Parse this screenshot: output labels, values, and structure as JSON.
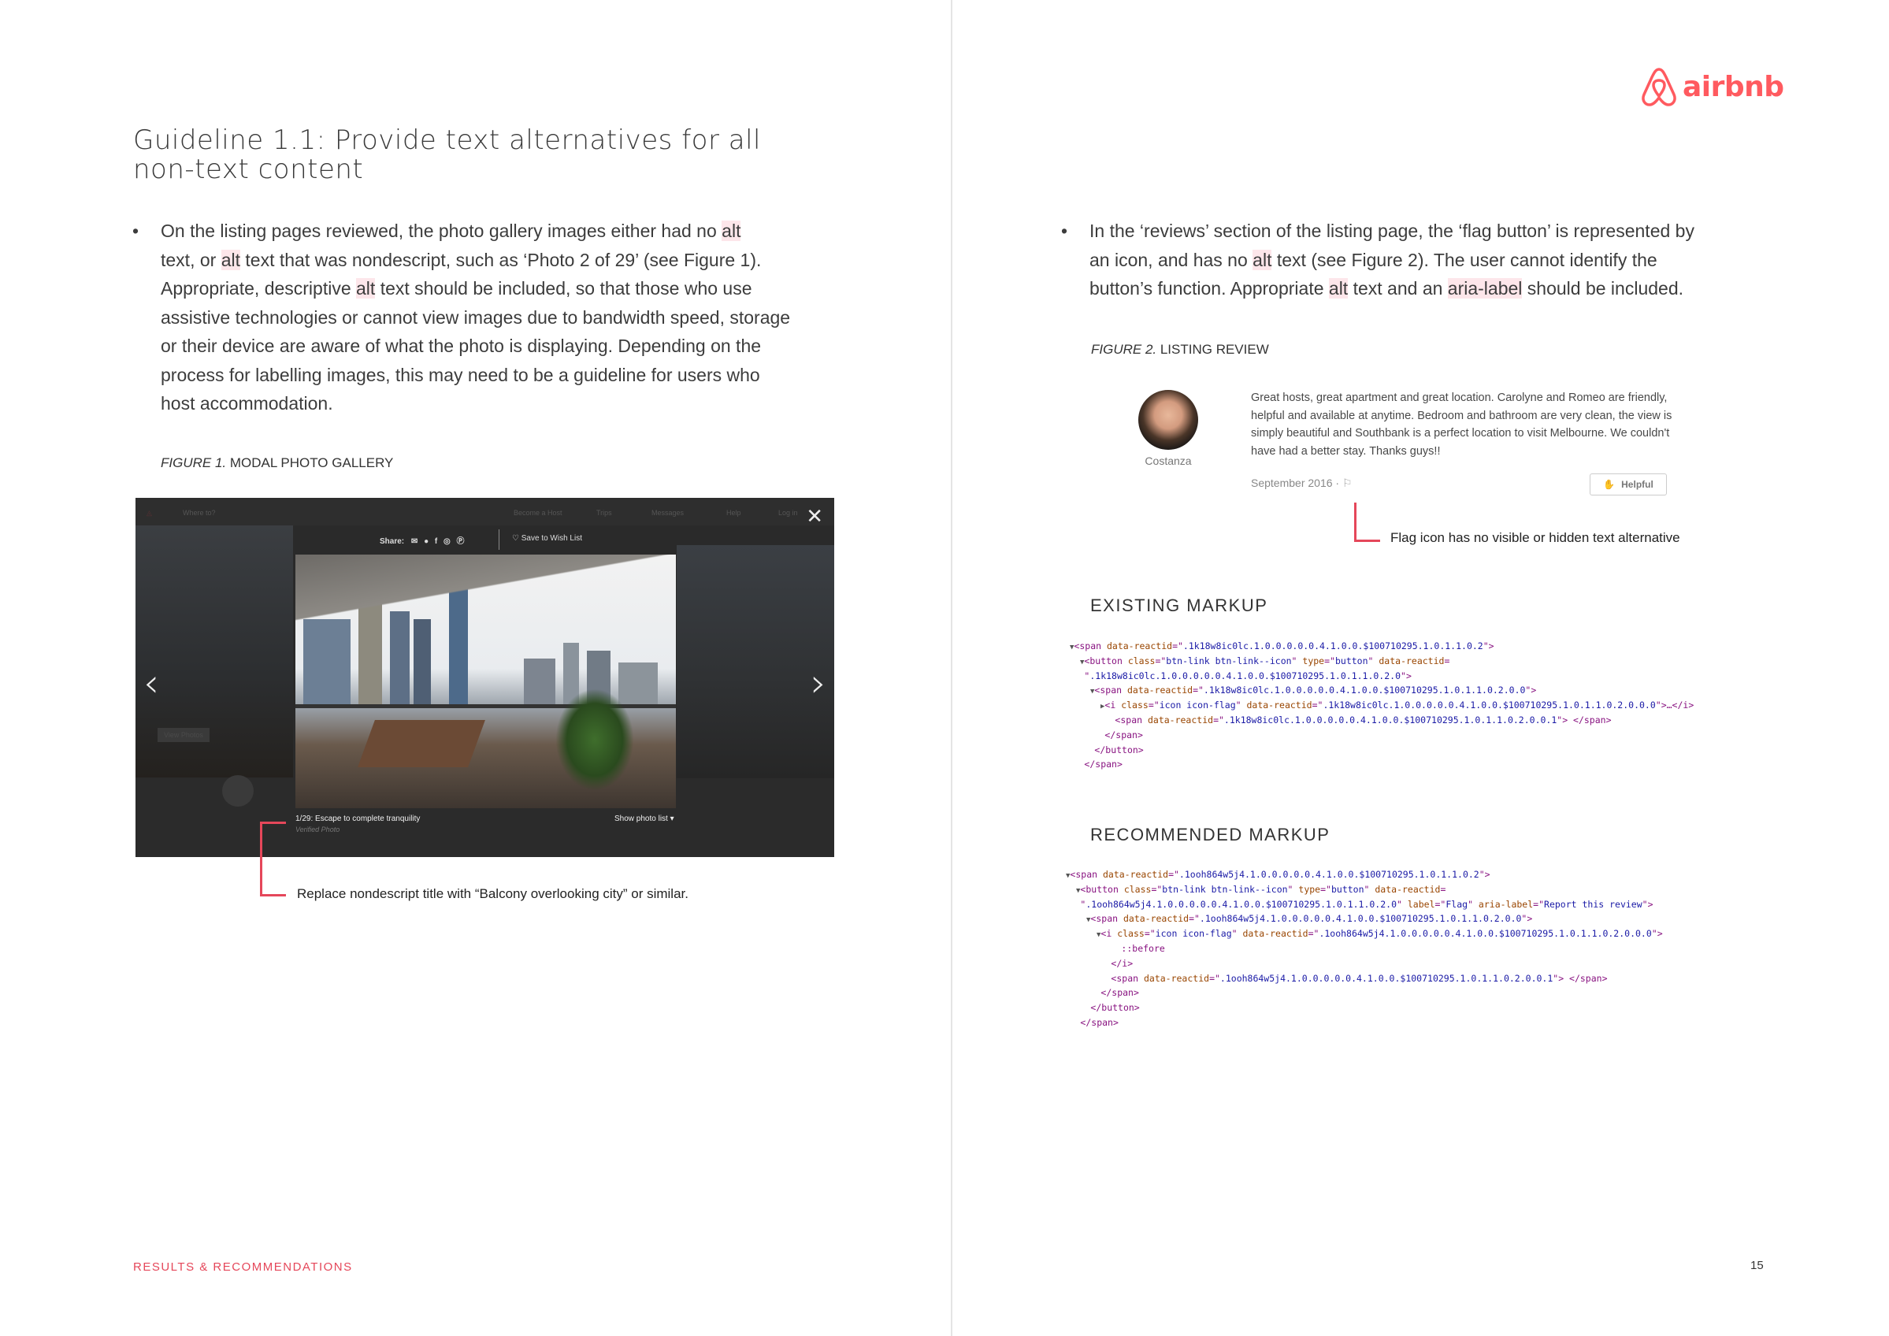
{
  "left_page": {
    "title_lines": [
      "Guideline 1.1: Provide text alternatives for all",
      "non-text content"
    ],
    "bullet_lines": [
      [
        {
          "text": "On the listing pages reviewed, the photo gallery images either had no "
        },
        {
          "text": "alt",
          "hl": true
        }
      ],
      [
        {
          "text": "text, or "
        },
        {
          "text": "alt",
          "hl": true
        },
        {
          "text": " text that was nondescript, such as ‘Photo 2 of 29’ (see Figure 1)."
        }
      ],
      [
        {
          "text": "Appropriate, descriptive "
        },
        {
          "text": "alt",
          "hl": true
        },
        {
          "text": " text should be included, so that those who use"
        }
      ],
      [
        {
          "text": "assistive technologies or cannot view images due to bandwidth speed, storage"
        }
      ],
      [
        {
          "text": "or their device are aware of what the photo is displaying. Depending on the"
        }
      ],
      [
        {
          "text": "process for labelling images, this may need to be a guideline for users who"
        }
      ],
      [
        {
          "text": "host accommodation."
        }
      ]
    ],
    "figure_caption": {
      "label": "FIGURE 1.",
      "text": " MODAL PHOTO GALLERY"
    },
    "gallery": {
      "nav_items": [
        "Where to?",
        "Become a Host",
        "Trips",
        "Messages",
        "Help",
        "Log in"
      ],
      "share_label": "Share:",
      "share_icons": [
        "✉",
        "●",
        "f",
        "◎",
        "Ⓟ"
      ],
      "wishlist_label": "♡ Save to Wish List",
      "close_icon": "✕",
      "prev_icon": "‹",
      "next_icon": "›",
      "photo_caption": "1/29: Escape to complete tranquility",
      "verified": "Verified Photo",
      "show_photo_list": "Show photo list ▾",
      "view_photos": "View Photos"
    },
    "annotation": "Replace nondescript title with “Balcony overlooking city” or similar.",
    "footer": "RESULTS & RECOMMENDATIONS"
  },
  "right_page": {
    "logo_word": "airbnb",
    "brand_color": "#ff5a5f",
    "bullet_lines": [
      [
        {
          "text": "In the ‘reviews’ section of the listing page, the ‘flag button’ is represented by"
        }
      ],
      [
        {
          "text": "an icon, and has no "
        },
        {
          "text": "alt",
          "hl": true
        },
        {
          "text": " text (see Figure 2). The user cannot identify the"
        }
      ],
      [
        {
          "text": "button’s function. Appropriate "
        },
        {
          "text": "alt",
          "hl": true
        },
        {
          "text": " text and an "
        },
        {
          "text": "aria-label",
          "hl": true
        },
        {
          "text": " should be included."
        }
      ]
    ],
    "figure_caption": {
      "label": "FIGURE 2.",
      "text": " LISTING REVIEW"
    },
    "review": {
      "reviewer": "Costanza",
      "text": "Great hosts, great apartment and great location. Carolyne and Romeo are friendly, helpful and available at anytime. Bedroom and bathroom are very clean, the view is simply beautiful and Southbank is a perfect location to visit Melbourne. We couldn't have had a better stay. Thanks guys!!",
      "date": "September 2016 ·",
      "flag_icon": "⚐",
      "helpful_icon": "✋",
      "helpful_label": "Helpful"
    },
    "annotation": "Flag icon has no visible or hidden text alternative",
    "existing_heading": "EXISTING MARKUP",
    "existing_code": [
      {
        "indent": 0,
        "tri": "▼",
        "tokens": [
          [
            "tag",
            "<span "
          ],
          [
            "attr",
            "data-reactid"
          ],
          [
            "tag",
            "=\""
          ],
          [
            "val",
            ".1k18w8ic0lc.1.0.0.0.0.0.4.1.0.0.$100710295.1.0.1.1.0.2"
          ],
          [
            "tag",
            "\">"
          ]
        ]
      },
      {
        "indent": 1,
        "tri": "▼",
        "tokens": [
          [
            "tag",
            "<button "
          ],
          [
            "attr",
            "class"
          ],
          [
            "tag",
            "=\""
          ],
          [
            "val",
            "btn-link btn-link--icon"
          ],
          [
            "tag",
            "\" "
          ],
          [
            "attr",
            "type"
          ],
          [
            "tag",
            "=\""
          ],
          [
            "val",
            "button"
          ],
          [
            "tag",
            "\" "
          ],
          [
            "attr",
            "data-reactid"
          ],
          [
            "tag",
            "="
          ]
        ]
      },
      {
        "indent": 1,
        "tri": "",
        "tokens": [
          [
            "tag",
            "\""
          ],
          [
            "val",
            ".1k18w8ic0lc.1.0.0.0.0.0.4.1.0.0.$100710295.1.0.1.1.0.2.0"
          ],
          [
            "tag",
            "\">"
          ]
        ]
      },
      {
        "indent": 2,
        "tri": "▼",
        "tokens": [
          [
            "tag",
            "<span "
          ],
          [
            "attr",
            "data-reactid"
          ],
          [
            "tag",
            "=\""
          ],
          [
            "val",
            ".1k18w8ic0lc.1.0.0.0.0.0.4.1.0.0.$100710295.1.0.1.1.0.2.0.0"
          ],
          [
            "tag",
            "\">"
          ]
        ]
      },
      {
        "indent": 3,
        "tri": "▶",
        "tokens": [
          [
            "tag",
            "<i "
          ],
          [
            "attr",
            "class"
          ],
          [
            "tag",
            "=\""
          ],
          [
            "val",
            "icon icon-flag"
          ],
          [
            "tag",
            "\" "
          ],
          [
            "attr",
            "data-reactid"
          ],
          [
            "tag",
            "=\""
          ],
          [
            "val",
            ".1k18w8ic0lc.1.0.0.0.0.0.4.1.0.0.$100710295.1.0.1.1.0.2.0.0.0"
          ],
          [
            "tag",
            "\">…</i>"
          ]
        ]
      },
      {
        "indent": 4,
        "tri": "",
        "tokens": [
          [
            "tag",
            "<span "
          ],
          [
            "attr",
            "data-reactid"
          ],
          [
            "tag",
            "=\""
          ],
          [
            "val",
            ".1k18w8ic0lc.1.0.0.0.0.0.4.1.0.0.$100710295.1.0.1.1.0.2.0.0.1"
          ],
          [
            "tag",
            "\"> </span>"
          ]
        ]
      },
      {
        "indent": 3,
        "tri": "",
        "tokens": [
          [
            "tag",
            "</span>"
          ]
        ]
      },
      {
        "indent": 2,
        "tri": "",
        "tokens": [
          [
            "tag",
            "</button>"
          ]
        ]
      },
      {
        "indent": 1,
        "tri": "",
        "tokens": [
          [
            "tag",
            "</span>"
          ]
        ]
      }
    ],
    "recommended_heading": "RECOMMENDED MARKUP",
    "recommended_code": [
      {
        "indent": 0,
        "tri": "▼",
        "tokens": [
          [
            "tag",
            "<span "
          ],
          [
            "attr",
            "data-reactid"
          ],
          [
            "tag",
            "=\""
          ],
          [
            "val",
            ".1ooh864w5j4.1.0.0.0.0.0.4.1.0.0.$100710295.1.0.1.1.0.2"
          ],
          [
            "tag",
            "\">"
          ]
        ]
      },
      {
        "indent": 1,
        "tri": "▼",
        "tokens": [
          [
            "tag",
            "<button "
          ],
          [
            "attr",
            "class"
          ],
          [
            "tag",
            "=\""
          ],
          [
            "val",
            "btn-link btn-link--icon"
          ],
          [
            "tag",
            "\" "
          ],
          [
            "attr",
            "type"
          ],
          [
            "tag",
            "=\""
          ],
          [
            "val",
            "button"
          ],
          [
            "tag",
            "\" "
          ],
          [
            "attr",
            "data-reactid"
          ],
          [
            "tag",
            "="
          ]
        ]
      },
      {
        "indent": 1,
        "tri": "",
        "tokens": [
          [
            "tag",
            "\""
          ],
          [
            "val",
            ".1ooh864w5j4.1.0.0.0.0.0.4.1.0.0.$100710295.1.0.1.1.0.2.0"
          ],
          [
            "tag",
            "\" "
          ],
          [
            "attr",
            "label"
          ],
          [
            "tag",
            "=\""
          ],
          [
            "val",
            "Flag"
          ],
          [
            "tag",
            "\" "
          ],
          [
            "attr",
            "aria-label"
          ],
          [
            "tag",
            "=\""
          ],
          [
            "val",
            "Report this review"
          ],
          [
            "tag",
            "\">"
          ]
        ]
      },
      {
        "indent": 2,
        "tri": "▼",
        "tokens": [
          [
            "tag",
            "<span "
          ],
          [
            "attr",
            "data-reactid"
          ],
          [
            "tag",
            "=\""
          ],
          [
            "val",
            ".1ooh864w5j4.1.0.0.0.0.0.4.1.0.0.$100710295.1.0.1.1.0.2.0.0"
          ],
          [
            "tag",
            "\">"
          ]
        ]
      },
      {
        "indent": 3,
        "tri": "▼",
        "tokens": [
          [
            "tag",
            "<i "
          ],
          [
            "attr",
            "class"
          ],
          [
            "tag",
            "=\""
          ],
          [
            "val",
            "icon icon-flag"
          ],
          [
            "tag",
            "\" "
          ],
          [
            "attr",
            "data-reactid"
          ],
          [
            "tag",
            "=\""
          ],
          [
            "val",
            ".1ooh864w5j4.1.0.0.0.0.0.4.1.0.0.$100710295.1.0.1.1.0.2.0.0.0"
          ],
          [
            "tag",
            "\">"
          ]
        ]
      },
      {
        "indent": 5,
        "tri": "",
        "tokens": [
          [
            "tag",
            "::before"
          ]
        ]
      },
      {
        "indent": 4,
        "tri": "",
        "tokens": [
          [
            "tag",
            "</i>"
          ]
        ]
      },
      {
        "indent": 4,
        "tri": "",
        "tokens": [
          [
            "tag",
            "<span "
          ],
          [
            "attr",
            "data-reactid"
          ],
          [
            "tag",
            "=\""
          ],
          [
            "val",
            ".1ooh864w5j4.1.0.0.0.0.0.4.1.0.0.$100710295.1.0.1.1.0.2.0.0.1"
          ],
          [
            "tag",
            "\"> </span>"
          ]
        ]
      },
      {
        "indent": 3,
        "tri": "",
        "tokens": [
          [
            "tag",
            "</span>"
          ]
        ]
      },
      {
        "indent": 2,
        "tri": "",
        "tokens": [
          [
            "tag",
            "</button>"
          ]
        ]
      },
      {
        "indent": 1,
        "tri": "",
        "tokens": [
          [
            "tag",
            "</span>"
          ]
        ]
      }
    ],
    "page_number": "15"
  }
}
